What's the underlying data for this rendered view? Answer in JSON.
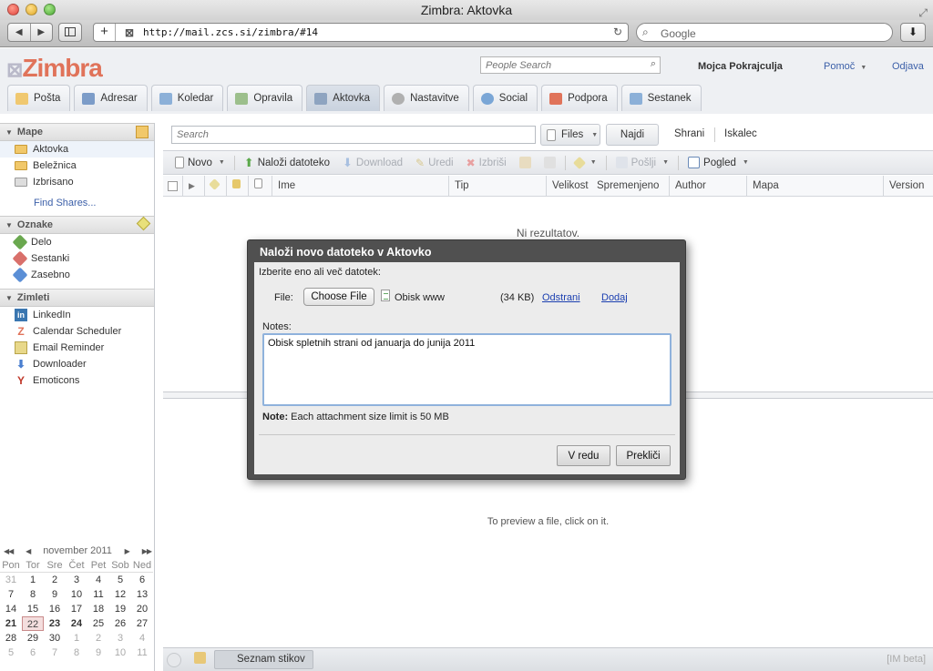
{
  "browser": {
    "window_title": "Zimbra: Aktovka",
    "url": "http://mail.zcs.si/zimbra/#14",
    "search_placeholder": "Google"
  },
  "header": {
    "logo": "Zimbra",
    "people_search_placeholder": "People Search",
    "user_name": "Mojca Pokrajculja",
    "help_label": "Pomoč",
    "logout_label": "Odjava"
  },
  "tabs": [
    {
      "label": "Pošta",
      "icon": "mail-icon"
    },
    {
      "label": "Adresar",
      "icon": "contacts-icon"
    },
    {
      "label": "Koledar",
      "icon": "calendar-icon"
    },
    {
      "label": "Opravila",
      "icon": "tasks-icon"
    },
    {
      "label": "Aktovka",
      "icon": "briefcase-icon",
      "active": true
    },
    {
      "label": "Nastavitve",
      "icon": "gear-icon"
    },
    {
      "label": "Social",
      "icon": "social-icon"
    },
    {
      "label": "Podpora",
      "icon": "support-icon"
    },
    {
      "label": "Sestanek",
      "icon": "meeting-icon"
    }
  ],
  "sidebar": {
    "folders_header": "Mape",
    "folders": [
      {
        "label": "Aktovka",
        "selected": true
      },
      {
        "label": "Beležnica"
      },
      {
        "label": "Izbrisano"
      }
    ],
    "find_shares": "Find Shares...",
    "tags_header": "Oznake",
    "tags": [
      {
        "label": "Delo",
        "color": "#6aa84f"
      },
      {
        "label": "Sestanki",
        "color": "#d9706b"
      },
      {
        "label": "Zasebno",
        "color": "#5b8fd6"
      }
    ],
    "zimlets_header": "Zimleti",
    "zimlets": [
      {
        "label": "LinkedIn",
        "icon": "linkedin-icon"
      },
      {
        "label": "Calendar Scheduler",
        "icon": "zimbra-icon"
      },
      {
        "label": "Email Reminder",
        "icon": "reminder-icon"
      },
      {
        "label": "Downloader",
        "icon": "download-icon"
      },
      {
        "label": "Emoticons",
        "icon": "yahoo-icon"
      }
    ]
  },
  "calendar": {
    "month": "november 2011",
    "days_of_week": [
      "Pon",
      "Tor",
      "Sre",
      "Čet",
      "Pet",
      "Sob",
      "Ned"
    ],
    "weeks": [
      [
        "31",
        "1",
        "2",
        "3",
        "4",
        "5",
        "6"
      ],
      [
        "7",
        "8",
        "9",
        "10",
        "11",
        "12",
        "13"
      ],
      [
        "14",
        "15",
        "16",
        "17",
        "18",
        "19",
        "20"
      ],
      [
        "21",
        "22",
        "23",
        "24",
        "25",
        "26",
        "27"
      ],
      [
        "28",
        "29",
        "30",
        "1",
        "2",
        "3",
        "4"
      ],
      [
        "5",
        "6",
        "7",
        "8",
        "9",
        "10",
        "11"
      ]
    ],
    "today": "22"
  },
  "search": {
    "placeholder": "Search",
    "type_label": "Files",
    "find_label": "Najdi",
    "save_label": "Shrani",
    "browse_label": "Iskalec"
  },
  "actions": {
    "new": "Novo",
    "upload": "Naloži datoteko",
    "download": "Download",
    "edit": "Uredi",
    "delete": "Izbriši",
    "send": "Pošlji",
    "view": "Pogled"
  },
  "columns": [
    "Ime",
    "Tip",
    "Velikost",
    "Spremenjeno",
    "Author",
    "Mapa",
    "Version"
  ],
  "list": {
    "empty_message": "Ni rezultatov."
  },
  "preview": {
    "hint": "To preview a file, click on it."
  },
  "statusbar": {
    "contacts_label": "Seznam stikov",
    "im_beta": "[IM beta]"
  },
  "dialog": {
    "title": "Naloži novo datoteko v Aktovko",
    "instructions": "Izberite eno ali več datotek:",
    "file_label": "File:",
    "choose_file_label": "Choose File",
    "file_name": "Obisk www",
    "file_size": "(34 KB)",
    "remove_label": "Odstrani",
    "add_label": "Dodaj",
    "notes_label": "Notes:",
    "notes_value": "Obisk spletnih strani od januarja do junija 2011",
    "note_prefix": "Note:",
    "note_text": "Each attachment size limit is 50 MB",
    "ok_label": "V redu",
    "cancel_label": "Prekliči"
  }
}
